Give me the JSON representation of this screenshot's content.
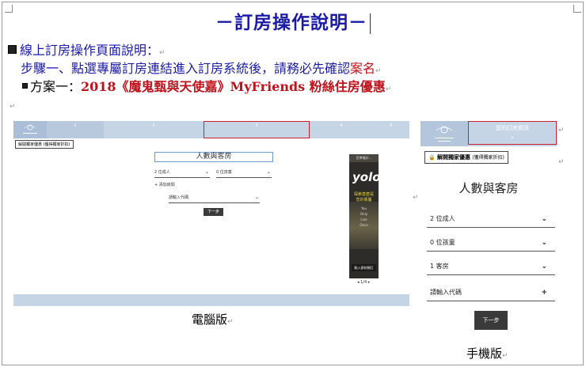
{
  "doc": {
    "title": "－訂房操作說明－",
    "heading": "線上訂房操作頁面說明：",
    "step1_text": "步驟一、點選專屬訂房連結進入訂房系統後，請務必先確認",
    "step1_highlight": "案名",
    "plan_label": "方案一：",
    "plan_name": "2018《魔鬼甄與天使嘉》MyFriends 粉絲住房優惠",
    "caption_desktop": "電腦版",
    "caption_mobile": "手機版",
    "para_mark": "↵"
  },
  "desktop": {
    "nav": [
      "1",
      "2",
      "3",
      "4",
      "5"
    ],
    "unlock_button": "解開獨家優惠 (獲得獨家折扣)",
    "section_title": "人數與客房",
    "adults": "2 位成人",
    "children": "0 位孩童",
    "add_room": "+ 添加房間",
    "promo_placeholder": "請輸入代碼",
    "next_button": "下一步",
    "ad": {
      "top": "您準備好...",
      "word": "yolo",
      "tagline": "探索甚麼是 您的專屬",
      "lines": [
        "You",
        "Only",
        "Live",
        "Once"
      ],
      "cta": "點入即刻預訂"
    },
    "ad_pager": "◂ 1/4 ▸"
  },
  "mobile": {
    "nav_label": "您的訂房資訊",
    "unlock_button": "解開獨家優惠",
    "unlock_note": "(獲得獨家折扣)",
    "section_title": "人數與客房",
    "adults": "2 位成人",
    "children": "0 位孩童",
    "rooms": "1 客房",
    "promo_placeholder": "請輸入代碼",
    "next_button": "下一步"
  },
  "colors": {
    "title_blue": "#1a1aa8",
    "highlight_red": "#c0121b",
    "nav_blue": "#c6d5e6",
    "frame_red": "#d01e2a"
  }
}
